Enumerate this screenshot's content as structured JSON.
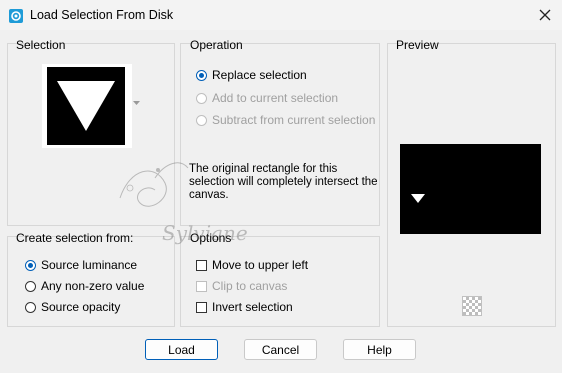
{
  "window": {
    "title": "Load Selection From Disk"
  },
  "selection_panel": {
    "legend": "Selection"
  },
  "operation_panel": {
    "legend": "Operation",
    "options": [
      {
        "label": "Replace selection",
        "selected": true,
        "enabled": true
      },
      {
        "label": "Add to current selection",
        "selected": false,
        "enabled": false
      },
      {
        "label": "Subtract from current selection",
        "selected": false,
        "enabled": false
      }
    ],
    "message": "The original rectangle for this selection will completely intersect the canvas."
  },
  "preview_panel": {
    "legend": "Preview"
  },
  "create_from_panel": {
    "legend": "Create selection from:",
    "options": [
      {
        "label": "Source luminance",
        "selected": true
      },
      {
        "label": "Any non-zero value",
        "selected": false
      },
      {
        "label": "Source opacity",
        "selected": false
      }
    ]
  },
  "options_panel": {
    "legend": "Options",
    "checkboxes": [
      {
        "label": "Move to upper left",
        "checked": false,
        "enabled": true
      },
      {
        "label": "Clip to canvas",
        "checked": false,
        "enabled": false
      },
      {
        "label": "Invert selection",
        "checked": false,
        "enabled": true
      }
    ]
  },
  "buttons": {
    "load": "Load",
    "cancel": "Cancel",
    "help": "Help"
  },
  "watermark": {
    "text": "Sylviane"
  },
  "colors": {
    "accent": "#005fb8",
    "panel_border": "#d7d7d7",
    "background": "#f0f0f0"
  }
}
